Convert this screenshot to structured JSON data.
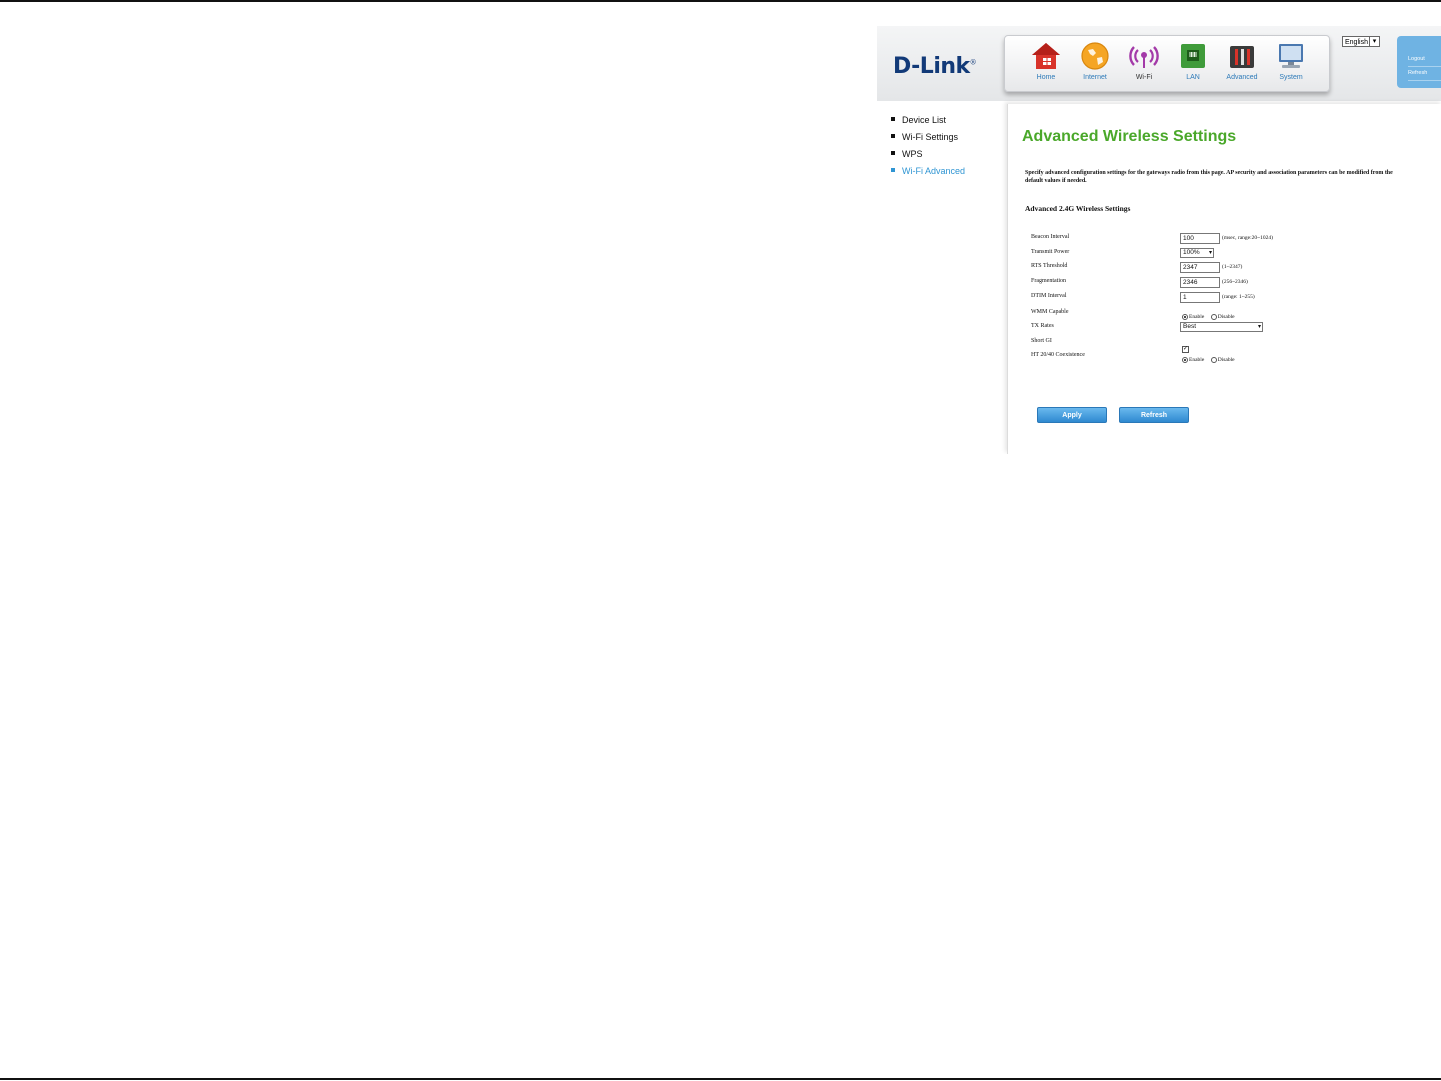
{
  "header": {
    "logo": "D-Link",
    "nav": [
      {
        "label": "Home",
        "icon": "home-icon"
      },
      {
        "label": "Internet",
        "icon": "globe-icon"
      },
      {
        "label": "Wi-Fi",
        "icon": "wifi-icon"
      },
      {
        "label": "LAN",
        "icon": "lan-icon"
      },
      {
        "label": "Advanced",
        "icon": "tools-icon"
      },
      {
        "label": "System",
        "icon": "monitor-icon"
      }
    ],
    "active_nav": "Wi-Fi",
    "language": "English",
    "logout": "Logout",
    "refresh": "Refresh"
  },
  "sidebar": {
    "items": [
      {
        "label": "Device List"
      },
      {
        "label": "Wi-Fi Settings"
      },
      {
        "label": "WPS"
      },
      {
        "label": "Wi-Fi Advanced"
      }
    ],
    "active": "Wi-Fi Advanced"
  },
  "main": {
    "title": "Advanced Wireless Settings",
    "description": "Specify advanced configuration settings for the gateways radio from this page. AP security and association parameters can be modified from the default values if needed.",
    "section_title": "Advanced 2.4G Wireless Settings",
    "fields": {
      "beacon_interval": {
        "label": "Beacon Interval",
        "value": "100",
        "hint": "(msec, range:20~1024)"
      },
      "transmit_power": {
        "label": "Transmit Power",
        "value": "100%"
      },
      "rts_threshold": {
        "label": "RTS Threshold",
        "value": "2347",
        "hint": "(1~2347)"
      },
      "fragmentation": {
        "label": "Fragmentation",
        "value": "2346",
        "hint": "(256~2346)"
      },
      "dtim_interval": {
        "label": "DTIM Interval",
        "value": "1",
        "hint": "(range: 1~255)"
      },
      "wmm_capable": {
        "label": "WMM Capable",
        "enable": "Enable",
        "disable": "Disable",
        "selected": "Enable"
      },
      "tx_rates": {
        "label": "TX Rates",
        "value": "Best"
      },
      "short_gi": {
        "label": "Short GI",
        "checked": true,
        "mark": "✓"
      },
      "ht_coexistence": {
        "label": "HT 20/40 Coexistence",
        "enable": "Enable",
        "disable": "Disable",
        "selected": "Enable"
      }
    },
    "buttons": {
      "apply": "Apply",
      "refresh": "Refresh"
    }
  },
  "colors": {
    "title_green": "#4aa82a",
    "active_blue": "#2f95d3",
    "button_blue": "#2f89d0",
    "logo_navy": "#123a78"
  }
}
